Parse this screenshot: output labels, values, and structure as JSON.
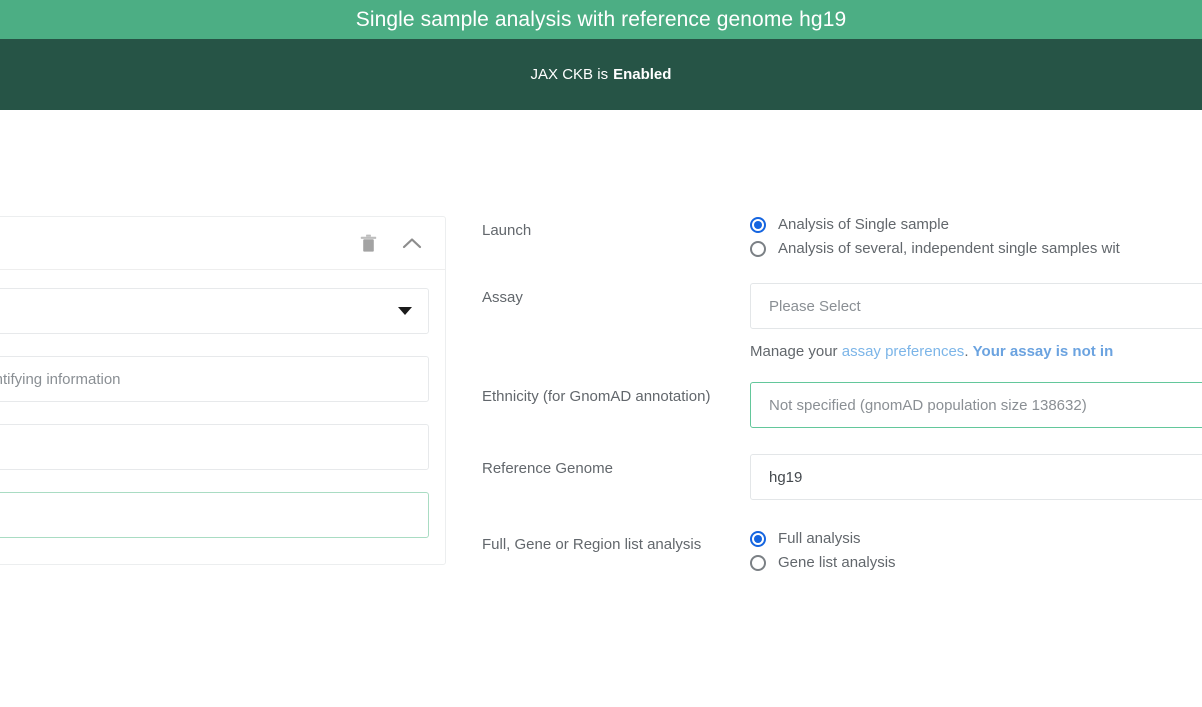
{
  "header": {
    "title": "Single sample analysis with reference genome hg19",
    "status_prefix": "JAX CKB is",
    "status_state": "Enabled",
    "title_bar_color": "#4cae84",
    "status_bar_color": "#265446"
  },
  "left_card": {
    "delete_icon": "trash-icon",
    "collapse_icon": "chevron-up-icon",
    "select_placeholder": "",
    "text_input_placeholder": "ept names or other personally identifying information",
    "input_3_value": "",
    "input_4_value": "",
    "focus_border_color": "#a9dcc3"
  },
  "form": {
    "launch": {
      "label": "Launch",
      "options": [
        {
          "label": "Analysis of Single sample",
          "checked": true
        },
        {
          "label": "Analysis of several, independent single samples wit",
          "checked": false
        }
      ]
    },
    "assay": {
      "label": "Assay",
      "value": "Please Select",
      "helper_prefix": "Manage your ",
      "helper_link": "assay preferences",
      "helper_middle": ". ",
      "helper_warning": "Your assay is not in"
    },
    "ethnicity": {
      "label": "Ethnicity (for GnomAD annotation)",
      "value": "Not specified (gnomAD population size 138632)",
      "border_color": "#63c79b"
    },
    "reference_genome": {
      "label": "Reference Genome",
      "value": "hg19"
    },
    "analysis_scope": {
      "label": "Full, Gene or Region list analysis",
      "options": [
        {
          "label": "Full analysis",
          "checked": true
        },
        {
          "label": "Gene list analysis",
          "checked": false
        }
      ]
    }
  },
  "colors": {
    "accent_green": "#4cae84",
    "dark_green": "#265446",
    "radio_blue": "#1565e0",
    "link_blue": "#7cb5e8"
  }
}
